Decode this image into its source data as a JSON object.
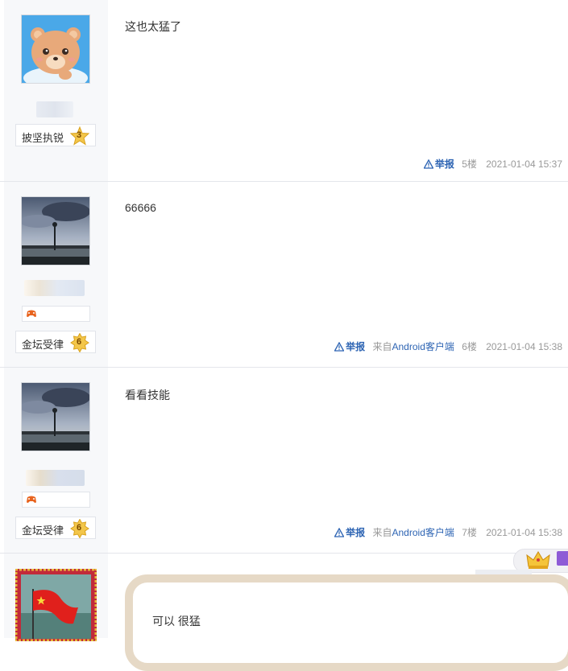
{
  "posts": [
    {
      "content": "这也太猛了",
      "level_name": "披坚执锐",
      "level_num": "3",
      "report": "举报",
      "source_prefix": "",
      "source_app": "",
      "floor": "5楼",
      "time": "2021-01-04 15:37",
      "avatar_icon": "bear-avatar-icon"
    },
    {
      "content": "66666",
      "level_name": "金坛受律",
      "level_num": "6",
      "report": "举报",
      "source_prefix": "来自",
      "source_app": "Android客户端",
      "floor": "6楼",
      "time": "2021-01-04 15:38",
      "avatar_icon": "lake-avatar-icon"
    },
    {
      "content": "看看技能",
      "level_name": "金坛受律",
      "level_num": "6",
      "report": "举报",
      "source_prefix": "来自",
      "source_app": "Android客户端",
      "floor": "7楼",
      "time": "2021-01-04 15:38",
      "avatar_icon": "lake-avatar-icon"
    },
    {
      "content": "可以 很猛",
      "avatar_icon": "flag-avatar-icon"
    }
  ],
  "colors": {
    "link": "#2d64b3",
    "muted": "#999999",
    "side_bg": "#f7f8fa",
    "frame": "#e6d9c6"
  }
}
